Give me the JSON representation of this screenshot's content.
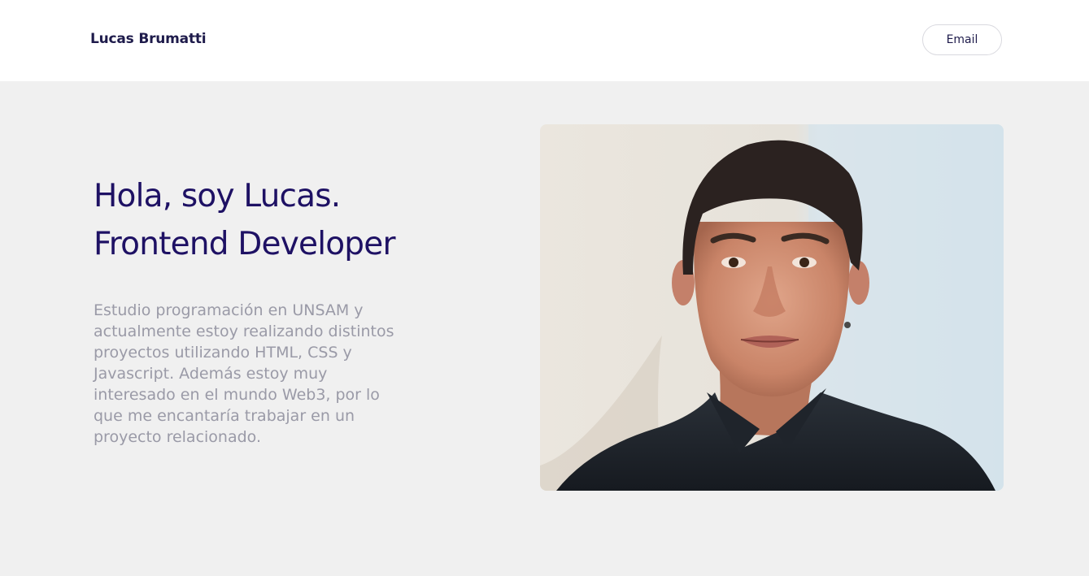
{
  "header": {
    "brand": "Lucas Brumatti",
    "email_label": "Email"
  },
  "hero": {
    "title_line1": "Hola, soy Lucas.",
    "title_line2": "Frontend Developer",
    "description": "Estudio programación en UNSAM y actualmente estoy realizando distintos proyectos utilizando HTML, CSS y Javascript. Además estoy muy interesado en el mundo Web3, por lo que me encantaría trabajar en un proyecto relacionado."
  },
  "colors": {
    "heading": "#1e1164",
    "body_text": "#9a9aa7",
    "background": "#f0f0f0",
    "header_bg": "#ffffff"
  }
}
